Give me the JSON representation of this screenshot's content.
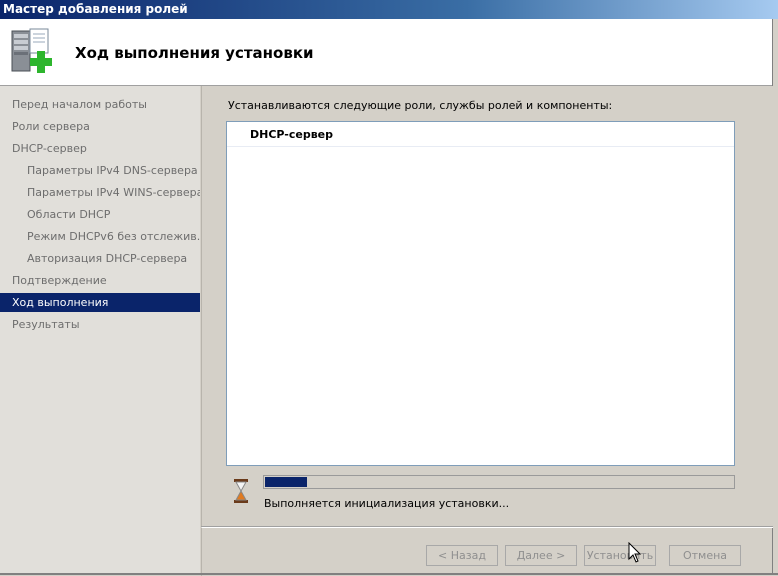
{
  "window": {
    "title": "Мастер добавления ролей"
  },
  "header": {
    "title": "Ход выполнения установки",
    "icon": "server-roles-add-icon"
  },
  "sidebar": {
    "items": [
      {
        "label": "Перед началом работы",
        "level": 1,
        "active": false
      },
      {
        "label": "Роли сервера",
        "level": 1,
        "active": false
      },
      {
        "label": "DHCP-сервер",
        "level": 1,
        "active": false
      },
      {
        "label": "Параметры IPv4 DNS-сервера",
        "level": 2,
        "active": false
      },
      {
        "label": "Параметры IPv4 WINS-сервера",
        "level": 2,
        "active": false
      },
      {
        "label": "Области DHCP",
        "level": 2,
        "active": false
      },
      {
        "label": "Режим DHCPv6 без отслежив...",
        "level": 2,
        "active": false
      },
      {
        "label": "Авторизация DHCP-сервера",
        "level": 2,
        "active": false
      },
      {
        "label": "Подтверждение",
        "level": 1,
        "active": false
      },
      {
        "label": "Ход выполнения",
        "level": 1,
        "active": true
      },
      {
        "label": "Результаты",
        "level": 1,
        "active": false
      }
    ]
  },
  "main": {
    "intro": "Устанавливаются следующие роли, службы ролей и компоненты:",
    "list": [
      "DHCP-сервер"
    ],
    "progress": 0.09,
    "status": "Выполняется инициализация установки..."
  },
  "buttons": {
    "back": "< Назад",
    "next": "Далее >",
    "install": "Установить",
    "cancel": "Отмена"
  },
  "colors": {
    "accent": "#0a246a",
    "selection": "#0a246a"
  }
}
